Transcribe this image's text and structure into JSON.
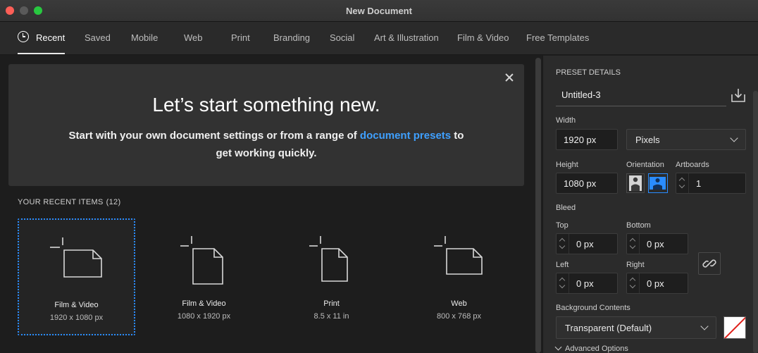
{
  "window": {
    "title": "New Document"
  },
  "tabs": [
    {
      "label": "Recent",
      "active": true
    },
    {
      "label": "Saved"
    },
    {
      "label": "Mobile"
    },
    {
      "label": "Web"
    },
    {
      "label": "Print"
    },
    {
      "label": "Branding"
    },
    {
      "label": "Social"
    },
    {
      "label": "Art & Illustration"
    },
    {
      "label": "Film & Video"
    },
    {
      "label": "Free Templates"
    }
  ],
  "hero": {
    "title": "Let’s start something new.",
    "sub_before": "Start with your own document settings or from a range of ",
    "sub_link": "document presets",
    "sub_after": " to get working quickly."
  },
  "recent": {
    "heading": "YOUR RECENT ITEMS",
    "count": "(12)",
    "items": [
      {
        "label": "Film & Video",
        "size": "1920 x 1080 px",
        "icon": "landscape-document-icon",
        "selected": true
      },
      {
        "label": "Film & Video",
        "size": "1080 x 1920 px",
        "icon": "portrait-document-icon"
      },
      {
        "label": "Print",
        "size": "8.5 x 11 in",
        "icon": "portrait-document-icon"
      },
      {
        "label": "Web",
        "size": "800 x 768 px",
        "icon": "landscape-document-icon"
      }
    ]
  },
  "preset": {
    "heading": "PRESET DETAILS",
    "name": "Untitled-3",
    "width_label": "Width",
    "width_value": "1920 px",
    "units": "Pixels",
    "height_label": "Height",
    "height_value": "1080 px",
    "orientation_label": "Orientation",
    "artboards_label": "Artboards",
    "artboards_value": "1",
    "bleed_label": "Bleed",
    "top_label": "Top",
    "top_value": "0 px",
    "bottom_label": "Bottom",
    "bottom_value": "0 px",
    "left_label": "Left",
    "left_value": "0 px",
    "right_label": "Right",
    "right_value": "0 px",
    "background_label": "Background Contents",
    "background_value": "Transparent (Default)",
    "advanced_label": "Advanced Options"
  },
  "colors": {
    "accent": "#2a8cff",
    "link": "#3fa0ff"
  }
}
